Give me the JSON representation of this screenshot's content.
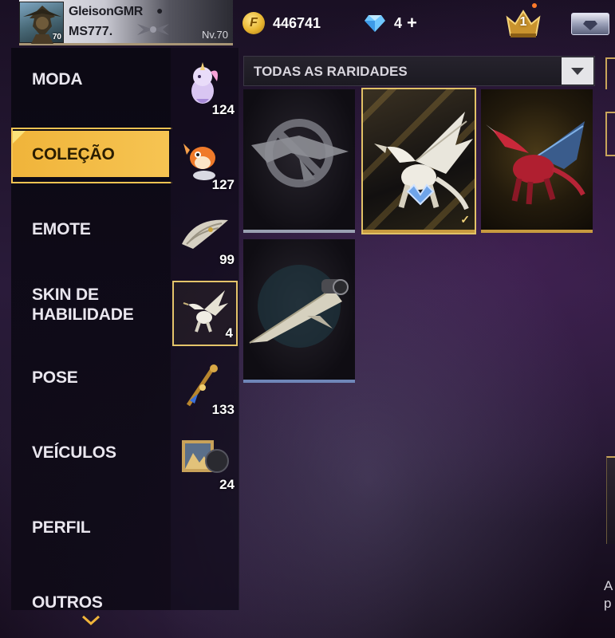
{
  "player": {
    "name": "GleisonGMR",
    "platform_icon": "apple-icon",
    "guild": "MS777.",
    "avatar_level": "70",
    "level_label": "Nv.70"
  },
  "currencies": {
    "gold_icon_letter": "F",
    "gold_amount": "446741",
    "diamond_amount": "4",
    "diamond_add": "+"
  },
  "rank_badge": {
    "number": "1"
  },
  "categories": [
    {
      "label": "MODA",
      "active": false
    },
    {
      "label": "COLEÇÃO",
      "active": true
    },
    {
      "label": "EMOTE",
      "active": false
    },
    {
      "label": "SKIN DE HABILIDADE",
      "active": false
    },
    {
      "label": "POSE",
      "active": false
    },
    {
      "label": "VEÍCULOS",
      "active": false
    },
    {
      "label": "PERFIL",
      "active": false
    },
    {
      "label": "OUTROS",
      "active": false
    }
  ],
  "sub_categories": [
    {
      "icon": "unicorn-pet-icon",
      "count": "124",
      "active": false
    },
    {
      "icon": "fish-pet-icon",
      "count": "127",
      "active": false
    },
    {
      "icon": "parachute-icon",
      "count": "99",
      "active": false
    },
    {
      "icon": "dragon-icon",
      "count": "4",
      "active": true
    },
    {
      "icon": "skyboard-icon",
      "count": "133",
      "active": false
    },
    {
      "icon": "banner-icon",
      "count": "24",
      "active": false
    }
  ],
  "filter": {
    "label": "TODAS AS RARIDADES"
  },
  "items": [
    {
      "name": "unequip-option",
      "rarity_color": "#9aa0b2",
      "selected": false
    },
    {
      "name": "white-dragon",
      "rarity_color": "#c79a3f",
      "selected": true,
      "equipped": true
    },
    {
      "name": "red-dragon",
      "rarity_color": "#c79a3f",
      "selected": false
    },
    {
      "name": "jet-glider",
      "rarity_color": "#6f86b8",
      "selected": false
    }
  ],
  "edge_text": "A p",
  "colors": {
    "accent_gold": "#f0b43a",
    "selected_border": "#e2c266",
    "menu_bg": "#0c0a14"
  }
}
